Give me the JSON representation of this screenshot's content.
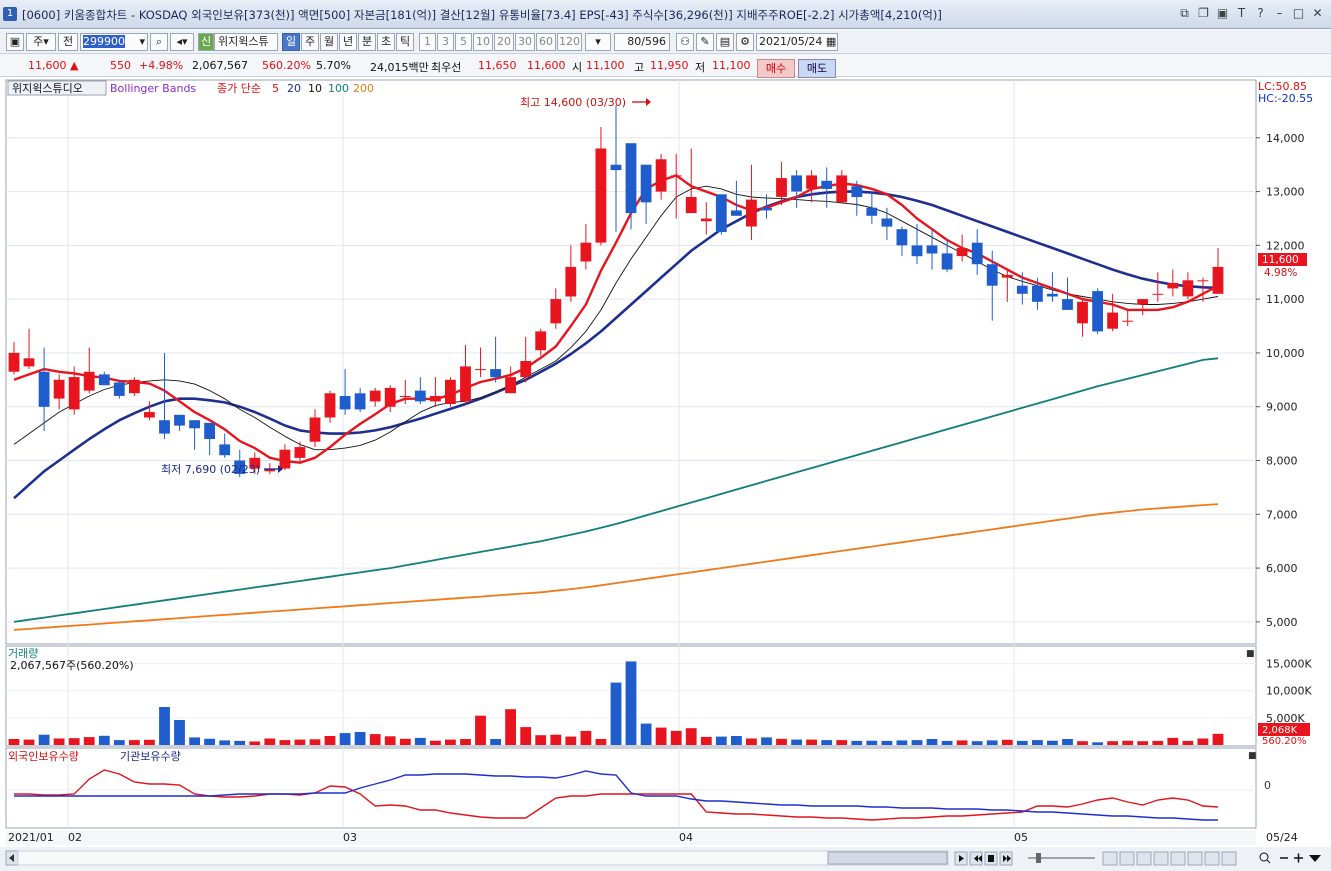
{
  "window": {
    "number": "1",
    "title": "[0600] 키움종합차트 - KOSDAQ 외국인보유[373(천)] 액면[500] 자본금[181(억)] 결산[12월] 유통비율[73.4] EPS[-43] 주식수[36,296(천)] 지배주주ROE[-2.2] 시가총액[4,210(억)]"
  },
  "toolbar": {
    "period_options": [
      "주",
      "전"
    ],
    "code": "299900",
    "stock_name": "위지윅스튜",
    "new_badge": "신",
    "intervals": [
      "일",
      "주",
      "월",
      "년",
      "분",
      "초",
      "틱"
    ],
    "selected_interval": "일",
    "counts": [
      "1",
      "3",
      "5",
      "10",
      "20",
      "30",
      "60",
      "120"
    ],
    "view_count": "80/596",
    "date": "2021/05/24"
  },
  "info": {
    "price": "11,600 ▲",
    "change": "550",
    "change_pct": "+4.98%",
    "volume": "2,067,567",
    "volume_ratio": "560.20%",
    "turnover": "5.70%",
    "amount": "24,015백만",
    "best_label": "최우선",
    "ask": "11,650",
    "bid": "11,600",
    "open_label": "시",
    "open": "11,100",
    "high_label": "고",
    "high": "11,950",
    "low_label": "저",
    "low": "11,100",
    "buy_label": "매수",
    "sell_label": "매도"
  },
  "legend": {
    "stock": "위지윅스튜디오",
    "bb": "Bollinger Bands",
    "ma_label": "종가 단순",
    "ma": [
      "5",
      "20",
      "10",
      "100",
      "200"
    ]
  },
  "annotations": {
    "max": "최고 14,600 (03/30)",
    "min": "최저 7,690 (02/23)"
  },
  "price_axis": {
    "ticks": [
      "14,000",
      "13,000",
      "12,000",
      "11,000",
      "10,000",
      "9,000",
      "8,000",
      "7,000",
      "6,000",
      "5,000"
    ],
    "lc": "LC:50.85",
    "hc": "HC:-20.55",
    "last": "11,600",
    "last_pct": "4.98%"
  },
  "volume_panel": {
    "title": "거래량",
    "value": "2,067,567주(560.20%)",
    "ticks": [
      "15,000K",
      "10,000K",
      "5,000K"
    ],
    "last": "2,068K",
    "last_pct": "560.20%"
  },
  "holding_panel": {
    "foreign": "외국인보유수량",
    "institution": "기관보유수량",
    "zero": "0"
  },
  "date_axis": [
    "2021/01",
    "02",
    "03",
    "04",
    "05",
    "05/24"
  ],
  "colors": {
    "up": "#e8141e",
    "down": "#1f5ccc",
    "ma5": "#e8141e",
    "ma10": "#111111",
    "ma20": "#1f2f8f",
    "ma100": "#0f7f7a",
    "ma200": "#ef7a1a"
  },
  "chart_data": {
    "type": "candlestick",
    "x": [
      "01/25",
      "01/26",
      "01/27",
      "01/28",
      "01/29",
      "02/01",
      "02/02",
      "02/03",
      "02/04",
      "02/05",
      "02/08",
      "02/09",
      "02/10",
      "02/15",
      "02/16",
      "02/17",
      "02/18",
      "02/19",
      "02/22",
      "02/23",
      "02/24",
      "02/25",
      "02/26",
      "03/02",
      "03/03",
      "03/04",
      "03/05",
      "03/08",
      "03/09",
      "03/10",
      "03/11",
      "03/12",
      "03/15",
      "03/16",
      "03/17",
      "03/18",
      "03/19",
      "03/22",
      "03/23",
      "03/24",
      "03/25",
      "03/26",
      "03/29",
      "03/30",
      "03/31",
      "04/01",
      "04/02",
      "04/05",
      "04/06",
      "04/07",
      "04/08",
      "04/09",
      "04/12",
      "04/13",
      "04/14",
      "04/15",
      "04/16",
      "04/19",
      "04/20",
      "04/21",
      "04/22",
      "04/23",
      "04/26",
      "04/27",
      "04/28",
      "04/29",
      "04/30",
      "05/03",
      "05/04",
      "05/06",
      "05/07",
      "05/10",
      "05/11",
      "05/12",
      "05/13",
      "05/14",
      "05/17",
      "05/18",
      "05/20",
      "05/21",
      "05/24"
    ],
    "open": [
      9650,
      9750,
      9650,
      9150,
      8950,
      9300,
      9600,
      9450,
      9250,
      8800,
      8750,
      8850,
      8750,
      8700,
      8300,
      8000,
      7850,
      7800,
      7850,
      8050,
      8350,
      8800,
      9200,
      9250,
      9100,
      9000,
      9200,
      9300,
      9100,
      9050,
      9100,
      9700,
      9700,
      9250,
      9550,
      10050,
      10550,
      11050,
      11700,
      12050,
      13500,
      13900,
      13500,
      13000,
      13300,
      12600,
      12450,
      12950,
      12650,
      12350,
      12700,
      12900,
      13300,
      13050,
      13200,
      12800,
      13100,
      12700,
      12500,
      12300,
      12000,
      12000,
      11850,
      11800,
      12050,
      11650,
      11400,
      11250,
      11250,
      11100,
      11000,
      10550,
      11150,
      10450,
      10600,
      10900,
      11100,
      11200,
      11050,
      11350,
      11100
    ],
    "close": [
      10000,
      9900,
      9000,
      9500,
      9550,
      9650,
      9400,
      9200,
      9500,
      8900,
      8500,
      8650,
      8600,
      8400,
      8100,
      7750,
      8050,
      7850,
      8200,
      8250,
      8800,
      9250,
      8950,
      8950,
      9300,
      9350,
      9200,
      9100,
      9200,
      9500,
      9750,
      9700,
      9550,
      9550,
      9850,
      10400,
      11000,
      11600,
      12050,
      13800,
      13400,
      12600,
      12800,
      13600,
      13300,
      12900,
      12500,
      12250,
      12550,
      12850,
      12650,
      13250,
      13000,
      13300,
      13050,
      13300,
      12900,
      12550,
      12350,
      12000,
      11800,
      11850,
      11550,
      11950,
      11650,
      11250,
      11450,
      11100,
      10950,
      11050,
      10800,
      10950,
      10400,
      10750,
      10600,
      11000,
      11100,
      11300,
      11350,
      11350,
      11600
    ],
    "high": [
      10200,
      10450,
      10100,
      9600,
      9750,
      10100,
      9650,
      9500,
      9550,
      9100,
      10000,
      8850,
      8750,
      8600,
      8500,
      8200,
      8150,
      7950,
      8300,
      8350,
      8950,
      9300,
      9700,
      9350,
      9350,
      9400,
      9500,
      9550,
      9550,
      9550,
      10150,
      10100,
      10300,
      9750,
      10300,
      10450,
      11200,
      12000,
      12400,
      14200,
      14600,
      13300,
      13400,
      13700,
      13700,
      13800,
      12800,
      12700,
      13200,
      13500,
      12950,
      13550,
      13400,
      13400,
      13450,
      13400,
      13200,
      13000,
      12700,
      12350,
      12400,
      12300,
      12100,
      12200,
      12300,
      11900,
      11550,
      11500,
      11400,
      11500,
      11400,
      11000,
      11200,
      11100,
      10800,
      11000,
      11500,
      11550,
      11500,
      11400,
      11950
    ],
    "low": [
      9600,
      9700,
      8550,
      8950,
      8850,
      9250,
      9400,
      9150,
      9200,
      8750,
      8400,
      8550,
      8200,
      8100,
      8050,
      7690,
      7750,
      7750,
      7820,
      7950,
      8250,
      8700,
      8850,
      8900,
      9000,
      8900,
      9050,
      9050,
      9000,
      9000,
      9050,
      9550,
      9450,
      9300,
      9450,
      9950,
      10450,
      10950,
      11550,
      12000,
      12250,
      12300,
      12400,
      12850,
      12500,
      12700,
      12200,
      12200,
      12550,
      12100,
      12500,
      12750,
      12700,
      12800,
      12700,
      12800,
      12550,
      12400,
      12100,
      11800,
      11650,
      11550,
      11500,
      11700,
      11450,
      10600,
      10950,
      10900,
      10800,
      10950,
      10850,
      10300,
      10350,
      10400,
      10500,
      10700,
      10950,
      11050,
      11000,
      10950,
      11100
    ],
    "volume": [
      1100,
      1000,
      1900,
      1200,
      1250,
      1450,
      1700,
      900,
      900,
      950,
      7000,
      4600,
      1400,
      1150,
      850,
      750,
      650,
      1200,
      900,
      1000,
      1050,
      1650,
      2200,
      2400,
      2000,
      1600,
      1150,
      1300,
      800,
      1000,
      1100,
      5400,
      1100,
      6600,
      3300,
      1800,
      1900,
      1550,
      2600,
      1100,
      11500,
      15400,
      3950,
      3200,
      2600,
      3100,
      1500,
      1550,
      1650,
      1200,
      1400,
      1150,
      1000,
      1000,
      900,
      900,
      750,
      800,
      750,
      850,
      900,
      1100,
      750,
      850,
      700,
      850,
      950,
      750,
      900,
      800,
      1100,
      700,
      500,
      700,
      800,
      700,
      750,
      1300,
      750,
      1200,
      2068
    ],
    "ma5": [
      9500,
      9600,
      9700,
      9650,
      9620,
      9570,
      9540,
      9480,
      9460,
      9430,
      9300,
      9100,
      8900,
      8750,
      8580,
      8360,
      8230,
      8050,
      7990,
      7960,
      8050,
      8250,
      8480,
      8680,
      8860,
      9050,
      9150,
      9150,
      9140,
      9220,
      9350,
      9460,
      9520,
      9590,
      9720,
      9910,
      10120,
      10500,
      10900,
      11530,
      12050,
      12600,
      13050,
      13200,
      13300,
      13100,
      13000,
      12900,
      12750,
      12650,
      12700,
      12800,
      12900,
      13050,
      13100,
      13150,
      13120,
      13050,
      12950,
      12750,
      12500,
      12300,
      12100,
      11950,
      11850,
      11700,
      11550,
      11400,
      11300,
      11200,
      11100,
      11000,
      10950,
      10900,
      10800,
      10800,
      10800,
      10850,
      10950,
      11100,
      11250
    ],
    "ma10": [
      8300,
      8500,
      8700,
      8900,
      9050,
      9200,
      9320,
      9400,
      9450,
      9480,
      9500,
      9480,
      9420,
      9300,
      9150,
      8950,
      8800,
      8620,
      8450,
      8300,
      8200,
      8200,
      8230,
      8280,
      8380,
      8530,
      8720,
      8900,
      9020,
      9080,
      9100,
      9170,
      9280,
      9400,
      9550,
      9700,
      9850,
      10100,
      10400,
      10800,
      11300,
      11750,
      12150,
      12550,
      12900,
      13050,
      13100,
      13050,
      12950,
      12900,
      12880,
      12870,
      12850,
      12830,
      12820,
      12790,
      12760,
      12700,
      12600,
      12450,
      12300,
      12150,
      12000,
      11850,
      11700,
      11550,
      11420,
      11330,
      11250,
      11170,
      11100,
      11050,
      11000,
      10950,
      10920,
      10900,
      10900,
      10920,
      10950,
      11000,
      11050
    ],
    "ma20": [
      7300,
      7550,
      7800,
      8000,
      8200,
      8400,
      8580,
      8750,
      8880,
      9000,
      9100,
      9150,
      9150,
      9120,
      9080,
      9000,
      8900,
      8780,
      8650,
      8560,
      8520,
      8500,
      8500,
      8520,
      8560,
      8620,
      8700,
      8780,
      8870,
      8960,
      9050,
      9150,
      9260,
      9380,
      9500,
      9650,
      9800,
      9980,
      10180,
      10400,
      10650,
      10900,
      11150,
      11400,
      11650,
      11900,
      12100,
      12300,
      12450,
      12600,
      12720,
      12820,
      12900,
      12950,
      12980,
      13000,
      13000,
      12980,
      12950,
      12900,
      12830,
      12750,
      12650,
      12550,
      12450,
      12350,
      12250,
      12150,
      12050,
      11950,
      11850,
      11750,
      11650,
      11550,
      11460,
      11380,
      11320,
      11270,
      11240,
      11220,
      11210
    ],
    "ma100": [
      5000,
      5040,
      5080,
      5120,
      5160,
      5200,
      5240,
      5280,
      5320,
      5360,
      5400,
      5440,
      5480,
      5520,
      5560,
      5600,
      5640,
      5680,
      5720,
      5760,
      5800,
      5840,
      5880,
      5920,
      5960,
      6000,
      6050,
      6100,
      6150,
      6200,
      6250,
      6300,
      6350,
      6400,
      6450,
      6500,
      6560,
      6620,
      6680,
      6750,
      6820,
      6900,
      6980,
      7060,
      7140,
      7220,
      7300,
      7380,
      7460,
      7540,
      7620,
      7700,
      7780,
      7860,
      7940,
      8020,
      8100,
      8180,
      8260,
      8340,
      8420,
      8500,
      8580,
      8660,
      8740,
      8820,
      8900,
      8980,
      9060,
      9140,
      9220,
      9300,
      9380,
      9450,
      9520,
      9590,
      9660,
      9730,
      9800,
      9870,
      9900
    ],
    "ma200": [
      4850,
      4870,
      4890,
      4910,
      4930,
      4950,
      4970,
      4990,
      5010,
      5030,
      5050,
      5070,
      5090,
      5110,
      5130,
      5150,
      5170,
      5190,
      5210,
      5230,
      5250,
      5270,
      5290,
      5310,
      5330,
      5350,
      5370,
      5390,
      5410,
      5430,
      5450,
      5470,
      5490,
      5510,
      5530,
      5550,
      5580,
      5610,
      5640,
      5680,
      5720,
      5760,
      5800,
      5840,
      5880,
      5920,
      5960,
      6000,
      6040,
      6080,
      6120,
      6160,
      6200,
      6240,
      6280,
      6320,
      6360,
      6400,
      6440,
      6480,
      6520,
      6560,
      6600,
      6640,
      6680,
      6720,
      6760,
      6800,
      6840,
      6880,
      6920,
      6960,
      7000,
      7030,
      7060,
      7090,
      7110,
      7130,
      7150,
      7170,
      7190
    ],
    "foreign_holding": [
      -0.2,
      -0.2,
      -0.25,
      -0.25,
      -0.2,
      0.55,
      1.0,
      0.8,
      0.4,
      0.3,
      0.3,
      0.25,
      -0.2,
      -0.3,
      -0.35,
      -0.35,
      -0.3,
      -0.2,
      -0.2,
      -0.25,
      -0.15,
      0.2,
      0.15,
      -0.2,
      -0.8,
      -0.75,
      -0.8,
      -1.0,
      -1.0,
      -1.15,
      -1.25,
      -1.35,
      -1.4,
      -1.4,
      -1.4,
      -0.9,
      -0.4,
      -0.3,
      -0.3,
      -0.2,
      -0.2,
      -0.2,
      -0.2,
      -0.2,
      -0.2,
      -0.2,
      -1.1,
      -1.15,
      -1.2,
      -1.2,
      -1.25,
      -1.3,
      -1.35,
      -1.35,
      -1.4,
      -1.4,
      -1.45,
      -1.5,
      -1.45,
      -1.4,
      -1.4,
      -1.35,
      -1.3,
      -1.3,
      -1.25,
      -1.2,
      -1.15,
      -1.1,
      -0.8,
      -0.8,
      -0.85,
      -0.7,
      -0.5,
      -0.4,
      -0.6,
      -0.75,
      -0.5,
      -0.4,
      -0.5,
      -0.8,
      -0.85
    ],
    "institution_holding": [
      -0.3,
      -0.3,
      -0.3,
      -0.3,
      -0.3,
      -0.3,
      -0.3,
      -0.3,
      -0.3,
      -0.3,
      -0.3,
      -0.3,
      -0.3,
      -0.3,
      -0.25,
      -0.2,
      -0.2,
      -0.2,
      -0.2,
      -0.2,
      -0.15,
      -0.15,
      -0.15,
      0.1,
      0.3,
      0.5,
      0.75,
      0.75,
      0.8,
      0.8,
      0.8,
      0.75,
      0.7,
      0.7,
      0.65,
      0.65,
      0.6,
      0.75,
      0.95,
      0.8,
      0.75,
      -0.15,
      -0.3,
      -0.3,
      -0.3,
      -0.45,
      -0.55,
      -0.55,
      -0.6,
      -0.65,
      -0.7,
      -0.75,
      -0.75,
      -0.8,
      -0.8,
      -0.8,
      -0.8,
      -0.85,
      -0.85,
      -0.9,
      -0.9,
      -0.9,
      -0.95,
      -0.95,
      -0.95,
      -1.0,
      -1.0,
      -1.05,
      -1.1,
      -1.1,
      -1.15,
      -1.2,
      -1.25,
      -1.3,
      -1.3,
      -1.35,
      -1.4,
      -1.4,
      -1.45,
      -1.5,
      -1.5
    ],
    "ylim": [
      4700,
      15000
    ],
    "volume_ylim": [
      0,
      17500
    ],
    "holding_ylim": [
      -1.8,
      1.8
    ]
  }
}
